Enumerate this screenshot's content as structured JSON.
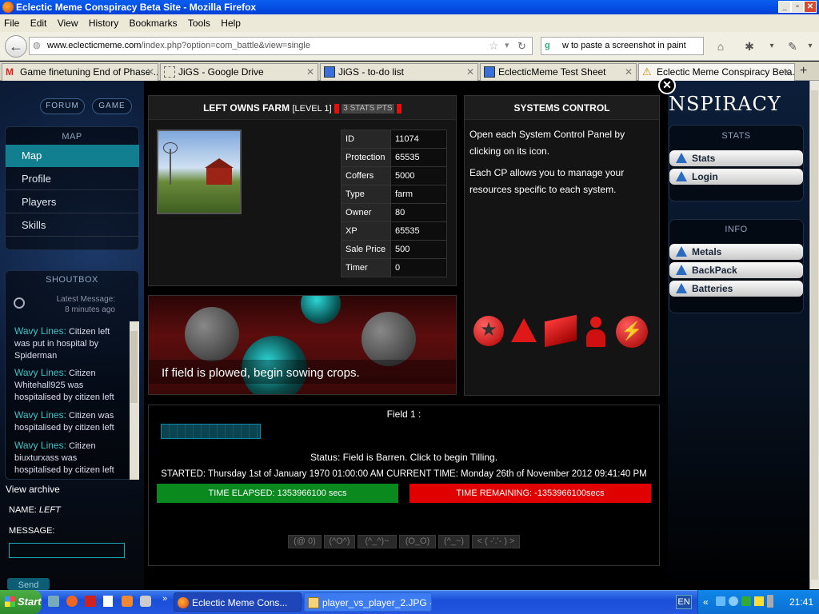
{
  "window": {
    "title": "Eclectic Meme Conspiracy Beta Site - Mozilla Firefox",
    "controls": {
      "minimize": "_",
      "maximize": "▫",
      "close": "✕"
    }
  },
  "menu": [
    "File",
    "Edit",
    "View",
    "History",
    "Bookmarks",
    "Tools",
    "Help"
  ],
  "nav": {
    "url_host": "www.eclecticmeme.com",
    "url_path": "/index.php?option=com_battle&view=single",
    "search_value": "w to paste a screenshot in paint"
  },
  "tabs": [
    {
      "label": "Game finetuning End of Phase ...",
      "icon": "gmail-icon",
      "active": false
    },
    {
      "label": "JiGS - Google Drive",
      "icon": "drive-icon",
      "active": false
    },
    {
      "label": "JiGS - to-do list",
      "icon": "doc-icon",
      "active": false
    },
    {
      "label": "EclecticMeme Test Sheet",
      "icon": "sheet-icon",
      "active": false
    },
    {
      "label": "Eclectic Meme Conspiracy Beta...",
      "icon": "warning-icon",
      "active": true
    }
  ],
  "colors": {
    "accent": "#117f8f",
    "shout_name": "#39c5c7",
    "elapsed": "#0a8a1e",
    "remaining": "#e00000"
  },
  "left": {
    "pills": [
      "FORUM",
      "GAME"
    ],
    "map_heading": "MAP",
    "nav_items": [
      {
        "label": "Map",
        "active": true
      },
      {
        "label": "Profile",
        "active": false
      },
      {
        "label": "Players",
        "active": false
      },
      {
        "label": "Skills",
        "active": false
      }
    ],
    "shoutbox_heading": "SHOUTBOX",
    "latest_label": "Latest Message:",
    "latest_time": "8 minutes ago",
    "shouts": [
      {
        "who": "Wavy Lines:",
        "text": " Citizen left was put in hospital by Spiderman"
      },
      {
        "who": "Wavy Lines:",
        "text": " Citizen Whitehall925 was hospitalised by citizen left"
      },
      {
        "who": "Wavy Lines:",
        "text": " Citizen was hospitalised by citizen left"
      },
      {
        "who": "Wavy Lines:",
        "text": " Citizen biuxturxass was hospitalised by citizen left"
      }
    ],
    "view_archive": "View archive",
    "name_label": "NAME:",
    "name_value": "LEFT",
    "message_label": "MESSAGE:",
    "send_label": "Send"
  },
  "farm": {
    "heading": "LEFT OWNS FARM",
    "level": "[LEVEL 1]",
    "stats_pts": "3 STATS PTS",
    "stats": [
      {
        "key": "ID",
        "value": "11074"
      },
      {
        "key": "Protection",
        "value": "65535"
      },
      {
        "key": "Coffers",
        "value": "5000"
      },
      {
        "key": "Type",
        "value": "farm"
      },
      {
        "key": "Owner",
        "value": "80"
      },
      {
        "key": "XP",
        "value": "65535"
      },
      {
        "key": "Sale Price",
        "value": "500"
      },
      {
        "key": "Timer",
        "value": "0"
      }
    ],
    "banner_text": "If field is plowed, begin sowing crops."
  },
  "systems": {
    "heading": "SYSTEMS CONTROL",
    "para1": "Open each System Control Panel by clicking on its icon.",
    "para2": "Each CP allows you to manage your resources specific to each system.",
    "icons": [
      "star-icon",
      "molecule-icon",
      "crate-icon",
      "person-icon",
      "bolt-icon"
    ]
  },
  "field": {
    "title": "Field 1 :",
    "status": "Status: Field is Barren. Click to begin Tilling.",
    "started": "STARTED: Thursday 1st of January 1970 01:00:00 AM CURRENT TIME: Monday 26th of November 2012 09:41:40 PM",
    "elapsed": "TIME ELAPSED: 1353966100 secs",
    "remaining": "TIME REMAINING: -1353966100secs",
    "emoticons": [
      "(@ 0)",
      "(^O^)",
      "(^_^)~",
      "(O_O)",
      "(^_~)",
      "< ( -'.'- ) >"
    ]
  },
  "right": {
    "brand": "NSPIRACY",
    "stats_heading": "STATS",
    "stats_buttons": [
      "Stats",
      "Login"
    ],
    "info_heading": "INFO",
    "info_buttons": [
      "Metals",
      "BackPack",
      "Batteries"
    ]
  },
  "taskbar": {
    "start": "Start",
    "tasks": [
      "Eclectic Meme Cons...",
      "player_vs_player_2.JPG - ..."
    ],
    "lang": "EN",
    "time": "21:41"
  }
}
